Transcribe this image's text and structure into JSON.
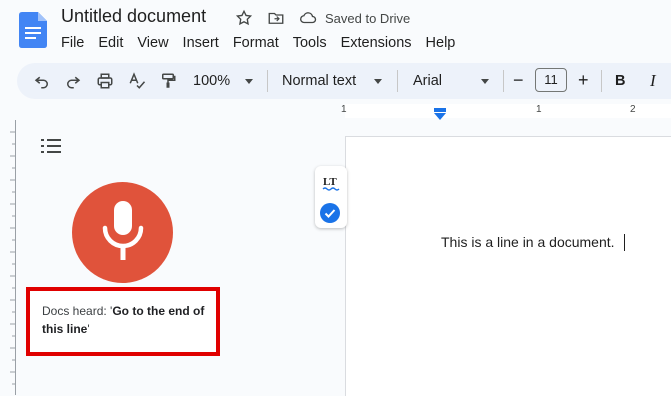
{
  "header": {
    "title": "Untitled document",
    "saved_status": "Saved to Drive",
    "menu": [
      "File",
      "Edit",
      "View",
      "Insert",
      "Format",
      "Tools",
      "Extensions",
      "Help"
    ]
  },
  "toolbar": {
    "zoom": "100%",
    "style": "Normal text",
    "font": "Arial",
    "font_size": "11",
    "bold_label": "B",
    "minus": "−",
    "plus": "+"
  },
  "ruler": {
    "marks": [
      "1",
      "1",
      "2"
    ]
  },
  "document": {
    "line": "This is a line in a document."
  },
  "voice_typing": {
    "heard_prefix": "Docs heard: '",
    "heard_command": "Go to the end of this line",
    "heard_suffix": "'"
  },
  "colors": {
    "mic": "#e0533b",
    "highlight_border": "#e00000",
    "docs_blue": "#4285f4"
  }
}
